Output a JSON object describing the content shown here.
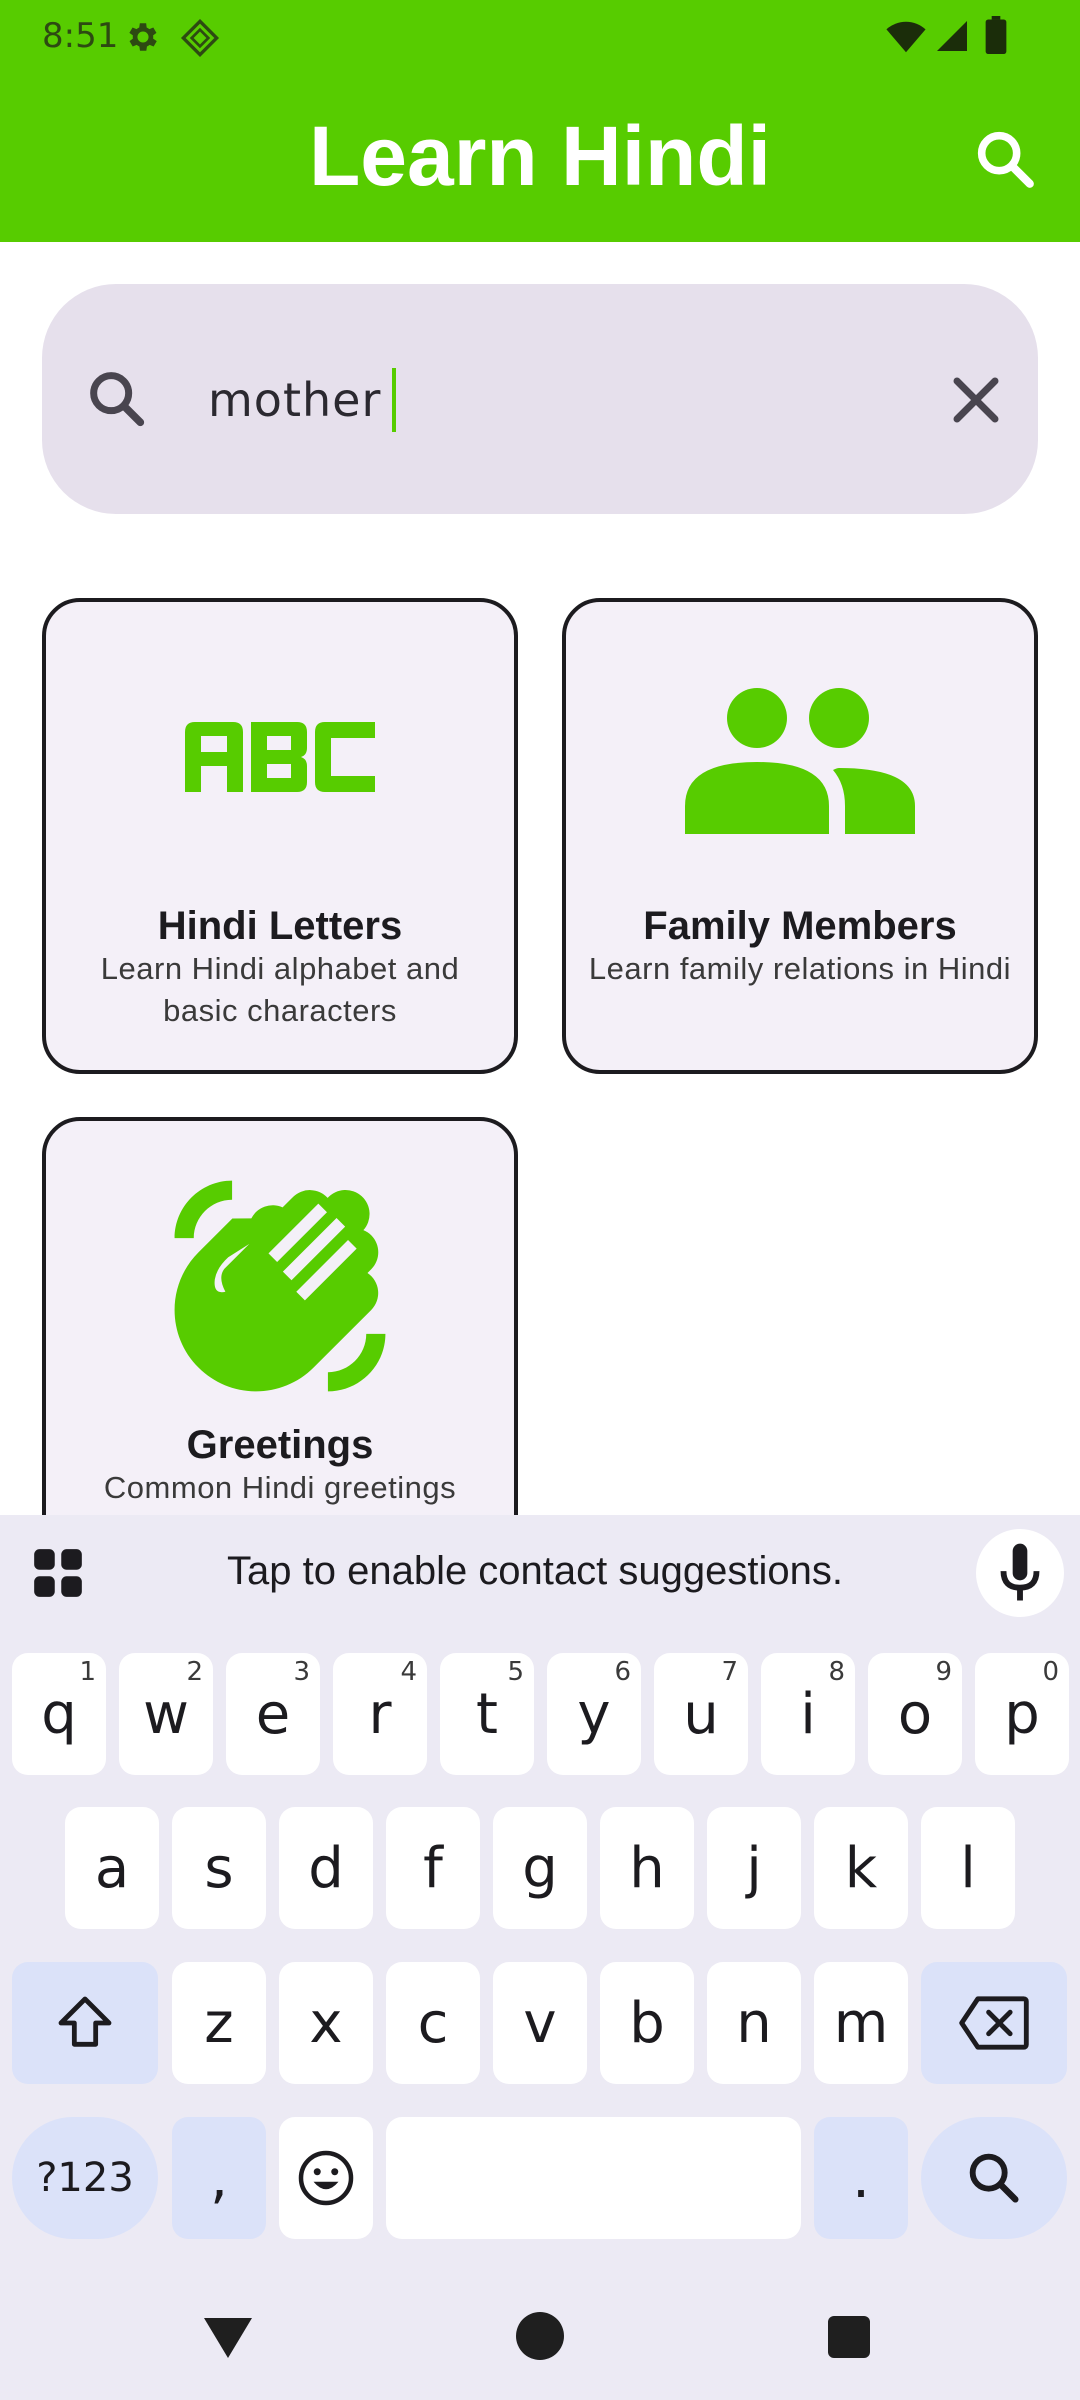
{
  "status_bar": {
    "time": "8:51",
    "icons": [
      "gear-icon",
      "diamond-icon",
      "wifi-icon",
      "signal-icon",
      "battery-icon"
    ]
  },
  "app_bar": {
    "title": "Learn Hindi",
    "action_icon": "search-icon"
  },
  "search": {
    "value": "mother",
    "placeholder": "",
    "leading_icon": "search-icon",
    "trailing_icon": "close-icon"
  },
  "categories": [
    {
      "title": "Hindi Letters",
      "description": "Learn Hindi alphabet and basic characters",
      "icon": "abc-icon"
    },
    {
      "title": "Family Members",
      "description": "Learn family relations in Hindi",
      "icon": "people-icon"
    },
    {
      "title": "Greetings",
      "description": "Common Hindi greetings",
      "icon": "waving-hand-icon"
    }
  ],
  "keyboard": {
    "suggestion": "Tap to enable contact suggestions.",
    "row1": [
      "q",
      "w",
      "e",
      "r",
      "t",
      "y",
      "u",
      "i",
      "o",
      "p"
    ],
    "row1_hints": [
      "1",
      "2",
      "3",
      "4",
      "5",
      "6",
      "7",
      "8",
      "9",
      "0"
    ],
    "row2": [
      "a",
      "s",
      "d",
      "f",
      "g",
      "h",
      "j",
      "k",
      "l"
    ],
    "row3": [
      "z",
      "x",
      "c",
      "v",
      "b",
      "n",
      "m"
    ],
    "symbols_label": "?123",
    "comma": ",",
    "period": "."
  },
  "colors": {
    "brand": "#57cc00",
    "search_bg": "#e6e0ec",
    "card_bg": "#f4f0f8",
    "keyboard_bg": "#eceaf4",
    "key_mod": "#dbe2f9"
  }
}
